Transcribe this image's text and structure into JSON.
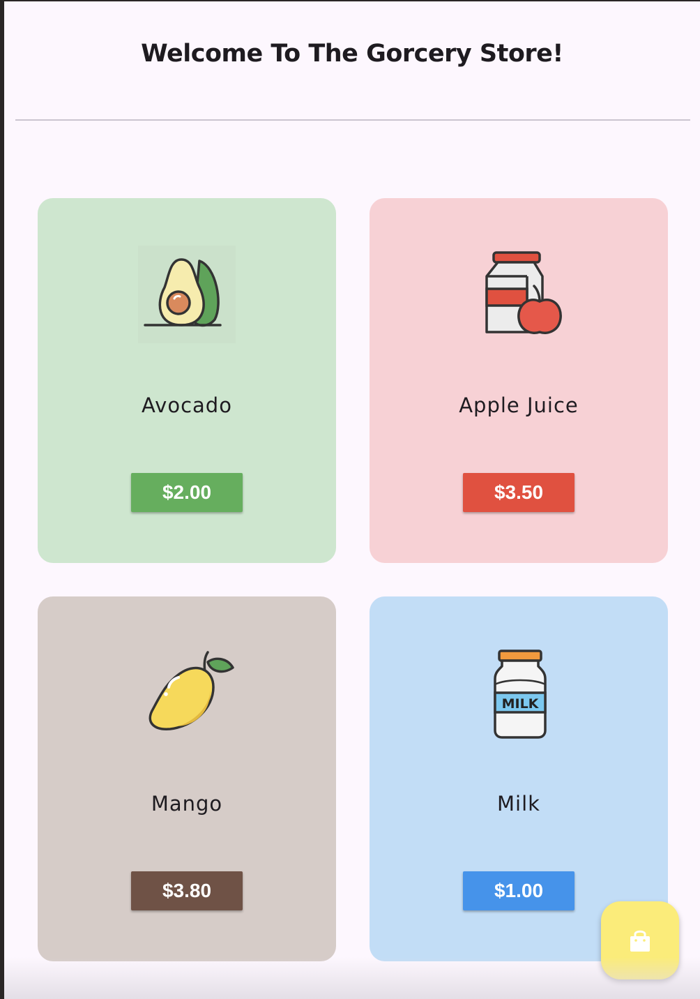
{
  "header": {
    "title": "Welcome To The Gorcery Store!"
  },
  "products": [
    {
      "name": "Avocado",
      "price": "$2.00",
      "icon": "avocado-icon",
      "card_color": "#cee6cf",
      "button_color": "#66ae5e"
    },
    {
      "name": "Apple Juice",
      "price": "$3.50",
      "icon": "apple-juice-icon",
      "card_color": "#f7d1d5",
      "button_color": "#e05140"
    },
    {
      "name": "Mango",
      "price": "$3.80",
      "icon": "mango-icon",
      "card_color": "#d6ccc8",
      "button_color": "#6f5246"
    },
    {
      "name": "Milk",
      "price": "$1.00",
      "icon": "milk-icon",
      "card_color": "#c2ddf6",
      "button_color": "#4693ea"
    }
  ],
  "cart_button": {
    "icon": "shopping-bag-icon",
    "color": "#fbec7a"
  }
}
